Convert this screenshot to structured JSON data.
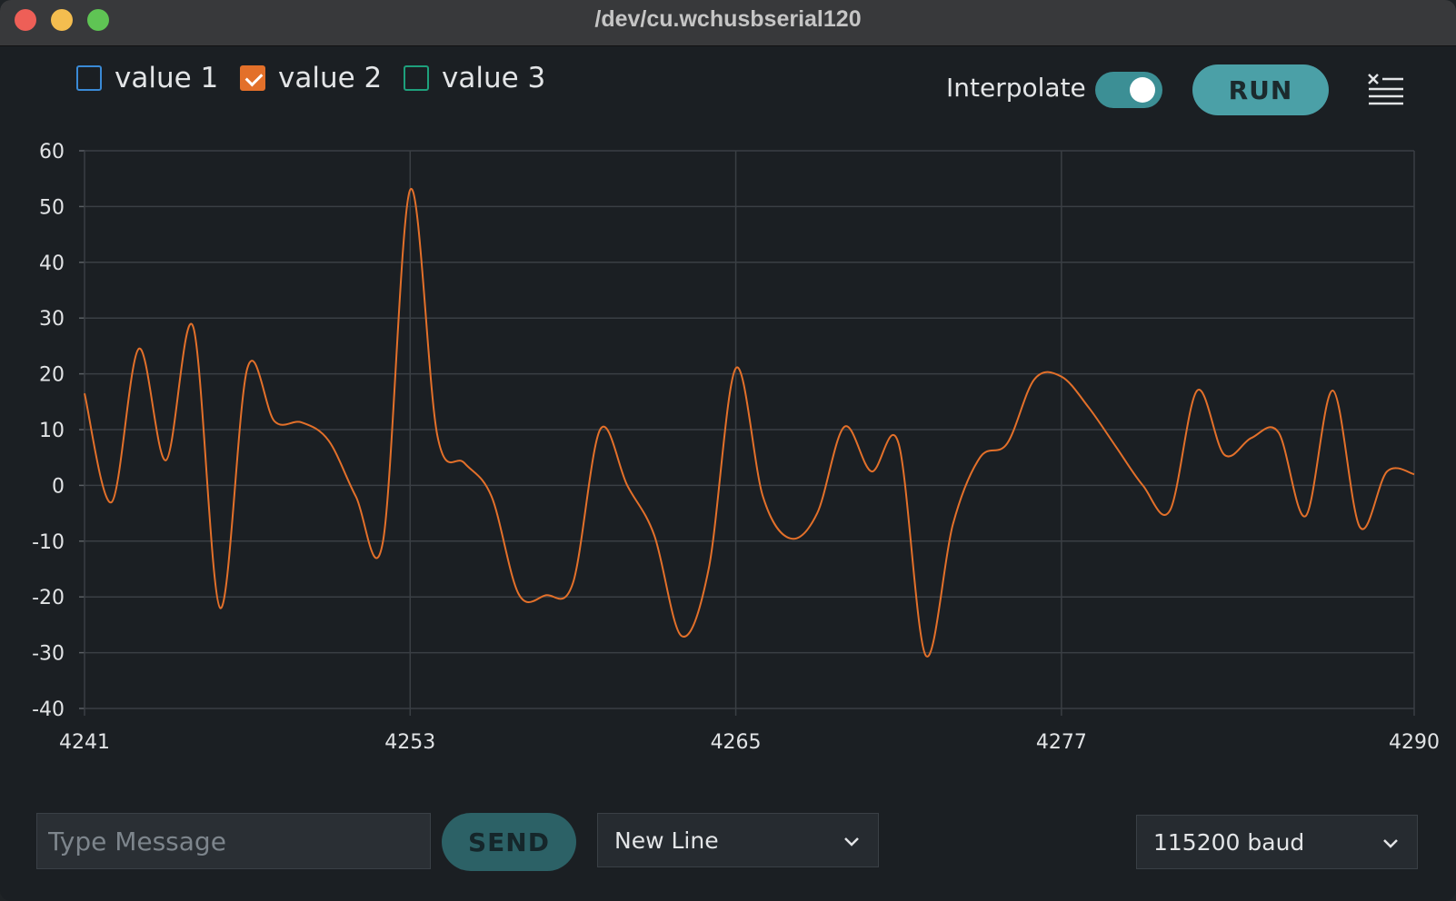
{
  "window": {
    "title": "/dev/cu.wchusbserial120"
  },
  "legend": [
    {
      "label": "value 1",
      "checked": false,
      "color": "#3a8ad6"
    },
    {
      "label": "value 2",
      "checked": true,
      "color": "#e3702a"
    },
    {
      "label": "value 3",
      "checked": false,
      "color": "#1ea07c"
    }
  ],
  "toolbar": {
    "interpolate_label": "Interpolate",
    "interpolate_on": true,
    "run_label": "RUN",
    "clear_icon": "clear-list-icon"
  },
  "chart_data": {
    "type": "line",
    "x_ticks": [
      "4241",
      "4253",
      "4265",
      "4277",
      "4290"
    ],
    "y_ticks": [
      "60",
      "50",
      "40",
      "30",
      "20",
      "10",
      "0",
      "-10",
      "-20",
      "-30",
      "-40"
    ],
    "xlim": [
      4241,
      4290
    ],
    "ylim": [
      -40,
      60
    ],
    "grid": true,
    "line_color": "#e3702a",
    "series": [
      {
        "name": "value 2",
        "x": [
          4241,
          4242,
          4243,
          4244,
          4245,
          4246,
          4247,
          4248,
          4249,
          4250,
          4251,
          4252,
          4253,
          4254,
          4255,
          4256,
          4257,
          4258,
          4259,
          4260,
          4261,
          4262,
          4263,
          4264,
          4265,
          4266,
          4267,
          4268,
          4269,
          4270,
          4271,
          4272,
          4273,
          4274,
          4275,
          4276,
          4277,
          4278,
          4279,
          4280,
          4281,
          4282,
          4283,
          4284,
          4285,
          4286,
          4287,
          4288,
          4289,
          4290
        ],
        "values": [
          16.5,
          -3,
          24.5,
          4.5,
          28.5,
          -22,
          21,
          11.5,
          11.3,
          8,
          -2,
          -10,
          53,
          9,
          4,
          -2,
          -19.5,
          -19.7,
          -17.5,
          10,
          0,
          -9,
          -27,
          -15,
          21,
          -2,
          -9.5,
          -5,
          10.5,
          2.5,
          7.5,
          -30.5,
          -7,
          5,
          7.5,
          19,
          19.5,
          14,
          7,
          0,
          -4.5,
          17,
          5.5,
          8.5,
          9.5,
          -5.5,
          17,
          -7.5,
          2.5,
          2
        ]
      }
    ]
  },
  "footer": {
    "message_placeholder": "Type Message",
    "send_label": "SEND",
    "line_ending": "New Line",
    "baud": "115200 baud"
  }
}
